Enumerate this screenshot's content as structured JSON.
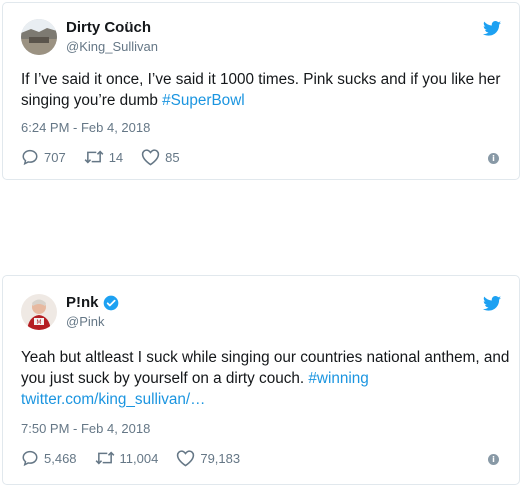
{
  "tweets": [
    {
      "display_name": "Dirty Coüch",
      "handle": "@King_Sullivan",
      "text_before": "If I’ve said it once, I’ve said it 1000 times. Pink sucks and if you like her singing you’re dumb ",
      "hashtag": "#SuperBowl",
      "time": "6:24 PM - Feb 4, 2018",
      "replies": "707",
      "retweets": "14",
      "likes": "85",
      "verified": false
    },
    {
      "display_name": "P!nk",
      "handle": "@Pink",
      "text_before": "Yeah but altleast I suck while singing our countries national anthem, and you just suck by yourself on a dirty couch. ",
      "hashtag": "#winning",
      "link": "twitter.com/king_sullivan/…",
      "time": "7:50 PM - Feb 4, 2018",
      "replies": "5,468",
      "retweets": "11,004",
      "likes": "79,183",
      "verified": true
    }
  ],
  "icons": {
    "brand": "twitter-bird-icon",
    "reply": "reply-icon",
    "retweet": "retweet-icon",
    "like": "heart-icon",
    "info": "info-icon",
    "verified": "verified-badge-icon"
  },
  "colors": {
    "link": "#1b95e0",
    "muted": "#657786",
    "border": "#e1e8ed",
    "text": "#14171a"
  }
}
